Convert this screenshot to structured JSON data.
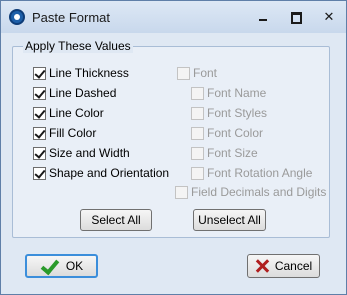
{
  "window": {
    "title": "Paste Format"
  },
  "group": {
    "label": "Apply These Values"
  },
  "left_options": [
    {
      "label": "Line Thickness",
      "checked": true
    },
    {
      "label": "Line Dashed",
      "checked": true
    },
    {
      "label": "Line Color",
      "checked": true
    },
    {
      "label": "Fill Color",
      "checked": true
    },
    {
      "label": "Size and Width",
      "checked": true
    },
    {
      "label": "Shape and Orientation",
      "checked": true
    }
  ],
  "right_options": {
    "font": {
      "label": "Font",
      "checked": false,
      "enabled": false
    },
    "font_children": [
      {
        "label": "Font Name",
        "checked": false,
        "enabled": false
      },
      {
        "label": "Font Styles",
        "checked": false,
        "enabled": false
      },
      {
        "label": "Font Color",
        "checked": false,
        "enabled": false
      },
      {
        "label": "Font Size",
        "checked": false,
        "enabled": false
      },
      {
        "label": "Font Rotation Angle",
        "checked": false,
        "enabled": false
      }
    ],
    "field_decimals": {
      "label": "Field Decimals and Digits",
      "checked": false,
      "enabled": false
    }
  },
  "buttons": {
    "select_all": "Select All",
    "unselect_all": "Unselect All",
    "ok": "OK",
    "cancel": "Cancel"
  }
}
